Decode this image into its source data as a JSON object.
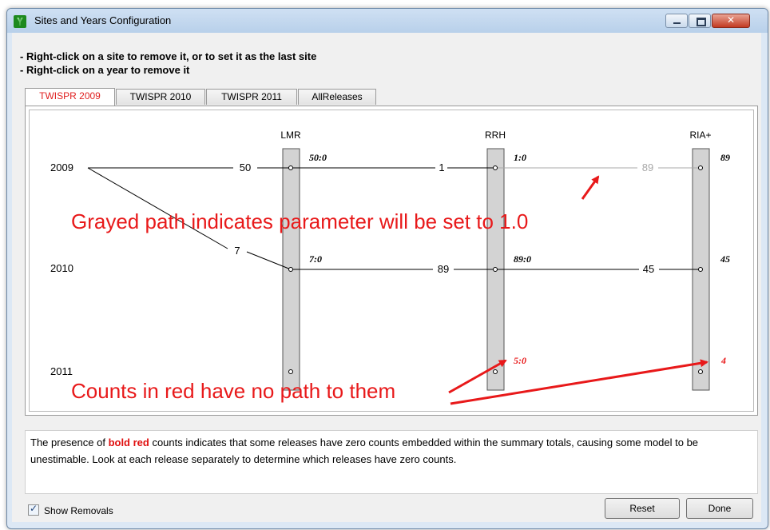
{
  "window": {
    "title": "Sites and Years Configuration"
  },
  "instructions": [
    "- Right-click on a site to remove it, or to set it as the last site",
    "- Right-click on a year to remove it"
  ],
  "tabs": [
    {
      "label": "TWISPR 2009",
      "active": true
    },
    {
      "label": "TWISPR 2010",
      "active": false
    },
    {
      "label": "TWISPR 2011",
      "active": false
    },
    {
      "label": "AllReleases",
      "active": false
    }
  ],
  "diagram": {
    "sites": [
      "LMR",
      "RRH",
      "RIA+"
    ],
    "years": [
      "2009",
      "2010",
      "2011"
    ],
    "connections": [
      {
        "from": "2009",
        "to": "LMR",
        "count": "50",
        "grayed": false
      },
      {
        "from": "LMR",
        "to": "RRH",
        "year": "2009",
        "count": "1",
        "grayed": false
      },
      {
        "from": "RRH",
        "to": "RIA+",
        "year": "2009",
        "count": "89",
        "grayed": true
      },
      {
        "from": "2009",
        "to": "LMR",
        "year_arrive": "2010",
        "count": "7",
        "grayed": false
      },
      {
        "from": "LMR",
        "to": "RRH",
        "year": "2010",
        "count": "89",
        "grayed": false
      },
      {
        "from": "RRH",
        "to": "RIA+",
        "year": "2010",
        "count": "45",
        "grayed": false
      }
    ],
    "node_counts": [
      {
        "site": "LMR",
        "year": "2009",
        "text": "50:0",
        "red": false
      },
      {
        "site": "RRH",
        "year": "2009",
        "text": "1:0",
        "red": false
      },
      {
        "site": "RIA+",
        "year": "2009",
        "text": "89",
        "red": false
      },
      {
        "site": "LMR",
        "year": "2010",
        "text": "7:0",
        "red": false
      },
      {
        "site": "RRH",
        "year": "2010",
        "text": "89:0",
        "red": false
      },
      {
        "site": "RIA+",
        "year": "2010",
        "text": "45",
        "red": false
      },
      {
        "site": "RRH",
        "year": "2011",
        "text": "5:0",
        "red": true
      },
      {
        "site": "RIA+",
        "year": "2011",
        "text": "4",
        "red": true
      }
    ],
    "annotations": [
      "Grayed path indicates parameter will be set to 1.0",
      "Counts in red have no path to them"
    ]
  },
  "description": {
    "before": "The presence of ",
    "highlight": "bold red",
    "after": " counts indicates that some releases have zero counts embedded within the summary totals, causing some model to be unestimable. Look at each release separately to determine which releases have zero counts."
  },
  "show_removals": {
    "label": "Show Removals",
    "checked": true
  },
  "buttons": {
    "reset": "Reset",
    "done": "Done"
  },
  "colors": {
    "annotation_red": "#e8191a",
    "gray_path": "#a8a8a8",
    "site_bar": "#d3d3d3",
    "active_tab_text": "#e02020"
  }
}
